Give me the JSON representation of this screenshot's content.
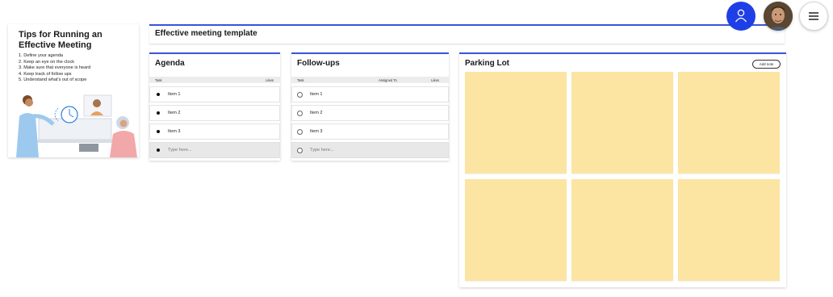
{
  "tips": {
    "title": "Tips for Running an Effective Meeting",
    "items": [
      "1. Define your agenda",
      "2. Keep an eye on the clock",
      "3. Make sure that everyone is heard",
      "4. Keep track of follow ups",
      "5. Understand what's out of scope"
    ]
  },
  "template_title": "Effective meeting template",
  "agenda": {
    "title": "Agenda",
    "columns": [
      "Task",
      "Likes"
    ],
    "items": [
      "Item 1",
      "Item 2",
      "Item 3"
    ],
    "placeholder": "Type here..."
  },
  "followups": {
    "title": "Follow-ups",
    "columns": [
      "Task",
      "Assigned To",
      "Likes"
    ],
    "items": [
      "Item 1",
      "Item 2",
      "Item 3"
    ],
    "placeholder": "Type here..."
  },
  "parking": {
    "title": "Parking Lot",
    "add_note_label": "Add note",
    "note_count": 6,
    "note_color": "#fce4a3"
  },
  "header_controls": {
    "user_icon": "user-icon",
    "menu_icon": "hamburger-menu-icon"
  },
  "colors": {
    "accent": "#3a55d9",
    "user_button": "#1f3fe6",
    "sticky_note": "#fce4a3"
  }
}
